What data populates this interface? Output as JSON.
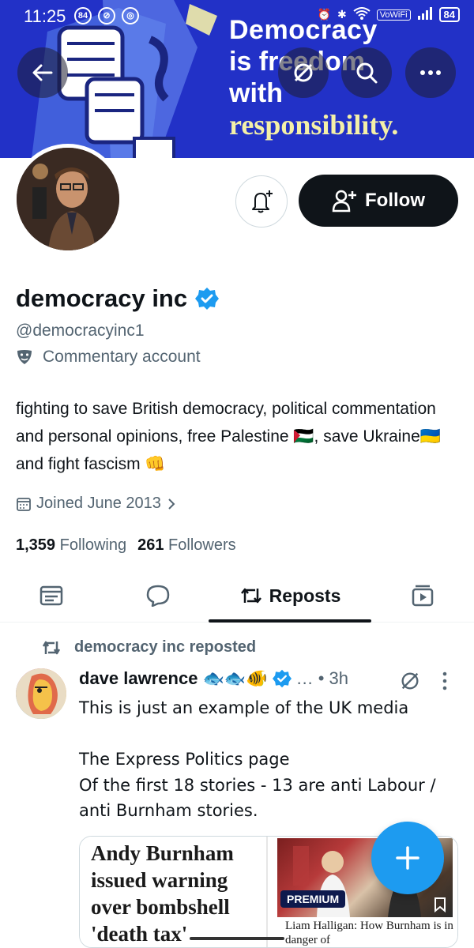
{
  "status_bar": {
    "time": "11:25",
    "notification_count": "84",
    "vowifi": "VoWiFi",
    "battery": "84"
  },
  "banner": {
    "line1": "Democracy",
    "line2": "is freedom",
    "line3": "with",
    "line4": "responsibility."
  },
  "actions": {
    "follow_label": "Follow"
  },
  "profile": {
    "name": "democracy inc",
    "handle": "@democracyinc1",
    "label": "Commentary account",
    "bio": "fighting to save British democracy, political commentation and personal opinions, free Palestine 🇵🇸, save Ukraine🇺🇦 and fight fascism 👊",
    "joined": "Joined June 2013",
    "following_count": "1,359",
    "following_label": "Following",
    "followers_count": "261",
    "followers_label": "Followers"
  },
  "tabs": {
    "active_label": "Reposts"
  },
  "post": {
    "reposted_by": "democracy inc reposted",
    "author_name": "dave lawrence",
    "author_emoji": "🐟🐟🐠",
    "meta": "… • 3h",
    "text": "This is just an example of the UK media\n\nThe Express Politics page\nOf the first 18 stories - 13 are anti Labour / anti Burnham stories.",
    "media": {
      "left_headline": "Andy Burnham issued warning over bombshell 'death tax'",
      "badge": "PREMIUM",
      "right_caption": "Liam Halligan: How Burnham is in danger of"
    }
  },
  "colors": {
    "accent": "#1d9bf0",
    "banner": "#2231c7",
    "verified": "#1d9bf0",
    "text_secondary": "#536471"
  }
}
